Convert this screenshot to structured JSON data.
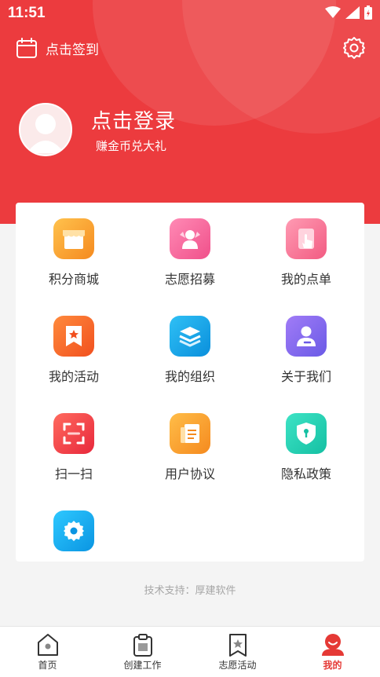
{
  "status_bar": {
    "time": "11:51"
  },
  "header": {
    "signin_label": "点击签到",
    "login_title": "点击登录",
    "login_subtitle": "赚金币兑大礼"
  },
  "menu": [
    {
      "label": "积分商城",
      "icon": "shop-icon",
      "color": "#f7a531"
    },
    {
      "label": "志愿招募",
      "icon": "volunteer-icon",
      "color": "#f75f9a"
    },
    {
      "label": "我的点单",
      "icon": "tap-order-icon",
      "color": "#f76f93"
    },
    {
      "label": "我的活动",
      "icon": "activity-star-icon",
      "color": "#f56b32"
    },
    {
      "label": "我的组织",
      "icon": "layers-icon",
      "color": "#14a7ec"
    },
    {
      "label": "关于我们",
      "icon": "user-card-icon",
      "color": "#8a6ff0"
    },
    {
      "label": "扫一扫",
      "icon": "scan-icon",
      "color": "#f0464b"
    },
    {
      "label": "用户协议",
      "icon": "agreement-icon",
      "color": "#f6a22c"
    },
    {
      "label": "隐私政策",
      "icon": "shield-icon",
      "color": "#2bd6b5"
    },
    {
      "label": "",
      "icon": "settings-gear-icon",
      "color": "#1ab0f0"
    }
  ],
  "footer": {
    "support_text": "技术支持：厚建软件"
  },
  "tabbar": [
    {
      "label": "首页",
      "icon": "home-icon",
      "active": false
    },
    {
      "label": "创建工作",
      "icon": "clipboard-icon",
      "active": false
    },
    {
      "label": "志愿活动",
      "icon": "bookmark-star-icon",
      "active": false
    },
    {
      "label": "我的",
      "icon": "profile-icon",
      "active": true
    }
  ],
  "colors": {
    "primary": "#ec3b3e",
    "active_tab": "#e53935"
  }
}
